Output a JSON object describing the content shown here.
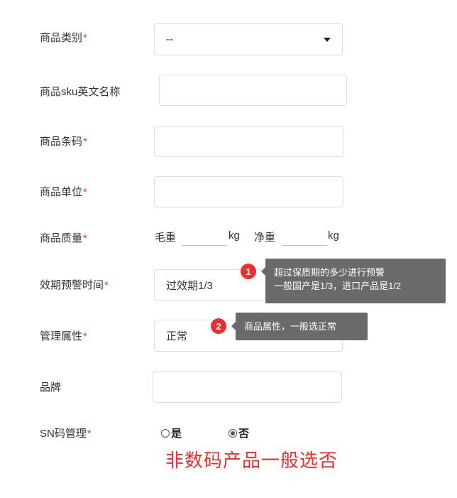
{
  "form": {
    "required_mark": "*",
    "category": {
      "label": "商品类别",
      "value": "--"
    },
    "sku_en_name": {
      "label": "商品sku英文名称",
      "value": ""
    },
    "barcode": {
      "label": "商品条码",
      "value": ""
    },
    "unit": {
      "label": "商品单位",
      "value": ""
    },
    "mass": {
      "label": "商品质量",
      "gross_label": "毛重",
      "gross_value": "",
      "gross_unit": "kg",
      "net_label": "净重",
      "net_value": "",
      "net_unit": "kg"
    },
    "expiry_warning": {
      "label": "效期预警时间",
      "value": "过效期1/3"
    },
    "management_attr": {
      "label": "管理属性",
      "value": "正常"
    },
    "brand": {
      "label": "品牌",
      "value": ""
    },
    "sn_management": {
      "label": "SN码管理",
      "options": [
        "是",
        "否"
      ],
      "selected": "否"
    }
  },
  "annotations": {
    "tip1": {
      "number": "1",
      "line1": "超过保质期的多少进行预警",
      "line2": "一般国产是1/3，进口产品是1/2"
    },
    "tip2": {
      "number": "2",
      "text": "商品属性，一般选正常"
    },
    "sn_note": "非数码产品一般选否"
  },
  "colors": {
    "required": "#e4393c",
    "annotation_red": "#ee2e2e",
    "tooltip_bg": "#6a6a6a",
    "border": "#dcdfe6"
  }
}
